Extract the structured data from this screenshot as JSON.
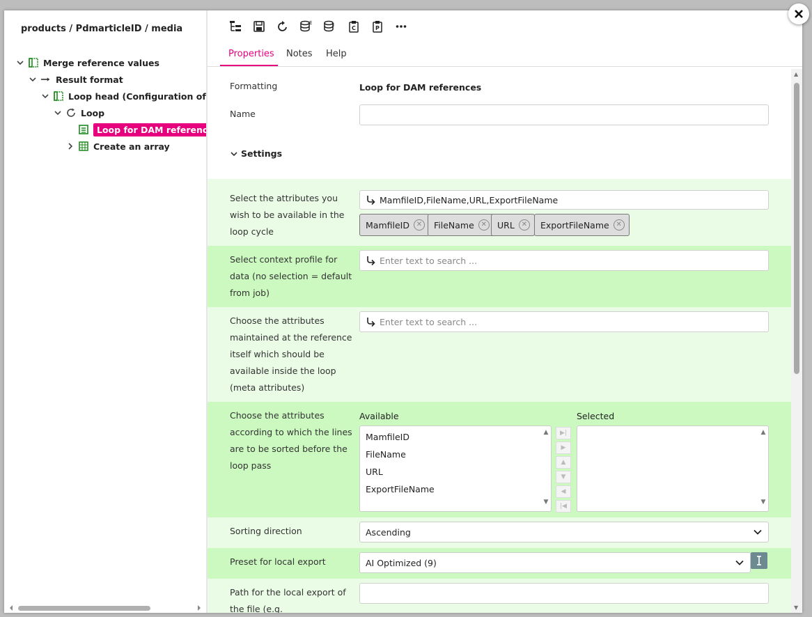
{
  "breadcrumb": "products / PdmarticleID / media",
  "tree": [
    {
      "label": "Merge reference values"
    },
    {
      "label": "Result format"
    },
    {
      "label": "Loop head (Configuration of loop"
    },
    {
      "label": "Loop"
    },
    {
      "label": "Loop for DAM references"
    },
    {
      "label": "Create an array"
    }
  ],
  "toolbar_icons": [
    "tree-structure-icon",
    "save-icon",
    "refresh-icon",
    "database-export-icon",
    "database-import-icon",
    "clipboard-copy-icon",
    "clipboard-paste-icon",
    "more-icon"
  ],
  "tabs": [
    {
      "label": "Properties"
    },
    {
      "label": "Notes"
    },
    {
      "label": "Help"
    }
  ],
  "form": {
    "formatting_label": "Formatting",
    "formatting_value": "Loop for DAM references",
    "name_label": "Name",
    "name_value": "",
    "settings_label": "Settings",
    "attributes": {
      "label_lines": [
        "Select the attributes you",
        "wish to be available in the",
        "loop cycle"
      ],
      "value": "MamfileID,FileName,URL,ExportFileName",
      "chips": [
        "MamfileID",
        "FileName",
        "URL",
        "ExportFileName"
      ]
    },
    "context_profile": {
      "label_lines": [
        "Select context profile for",
        "data (no selection = default",
        "from job)"
      ],
      "placeholder": "Enter text to search ..."
    },
    "meta_attributes": {
      "label_lines": [
        "Choose the attributes",
        "maintained at the reference",
        "itself which should be",
        "available inside the loop",
        "(meta attributes)"
      ],
      "placeholder": "Enter text to search ..."
    },
    "sort": {
      "label_lines": [
        "Choose the attributes",
        "according to which the lines",
        "are to be sorted before the",
        "loop pass"
      ],
      "available_label": "Available",
      "selected_label": "Selected",
      "available_items": [
        "MamfileID",
        "FileName",
        "URL",
        "ExportFileName"
      ]
    },
    "sorting_direction": {
      "label": "Sorting direction",
      "value": "Ascending"
    },
    "preset": {
      "label": "Preset for local export",
      "value": "AI Optimized (9)"
    },
    "path": {
      "label_lines": [
        "Path for the local export of",
        "the file (e.g."
      ],
      "value": ""
    }
  },
  "colors": {
    "accent": "#e6007e",
    "band_light": "#eafbe6",
    "band_green": "#cbf9c0",
    "tree_icon_green": "#1a8a1a"
  }
}
